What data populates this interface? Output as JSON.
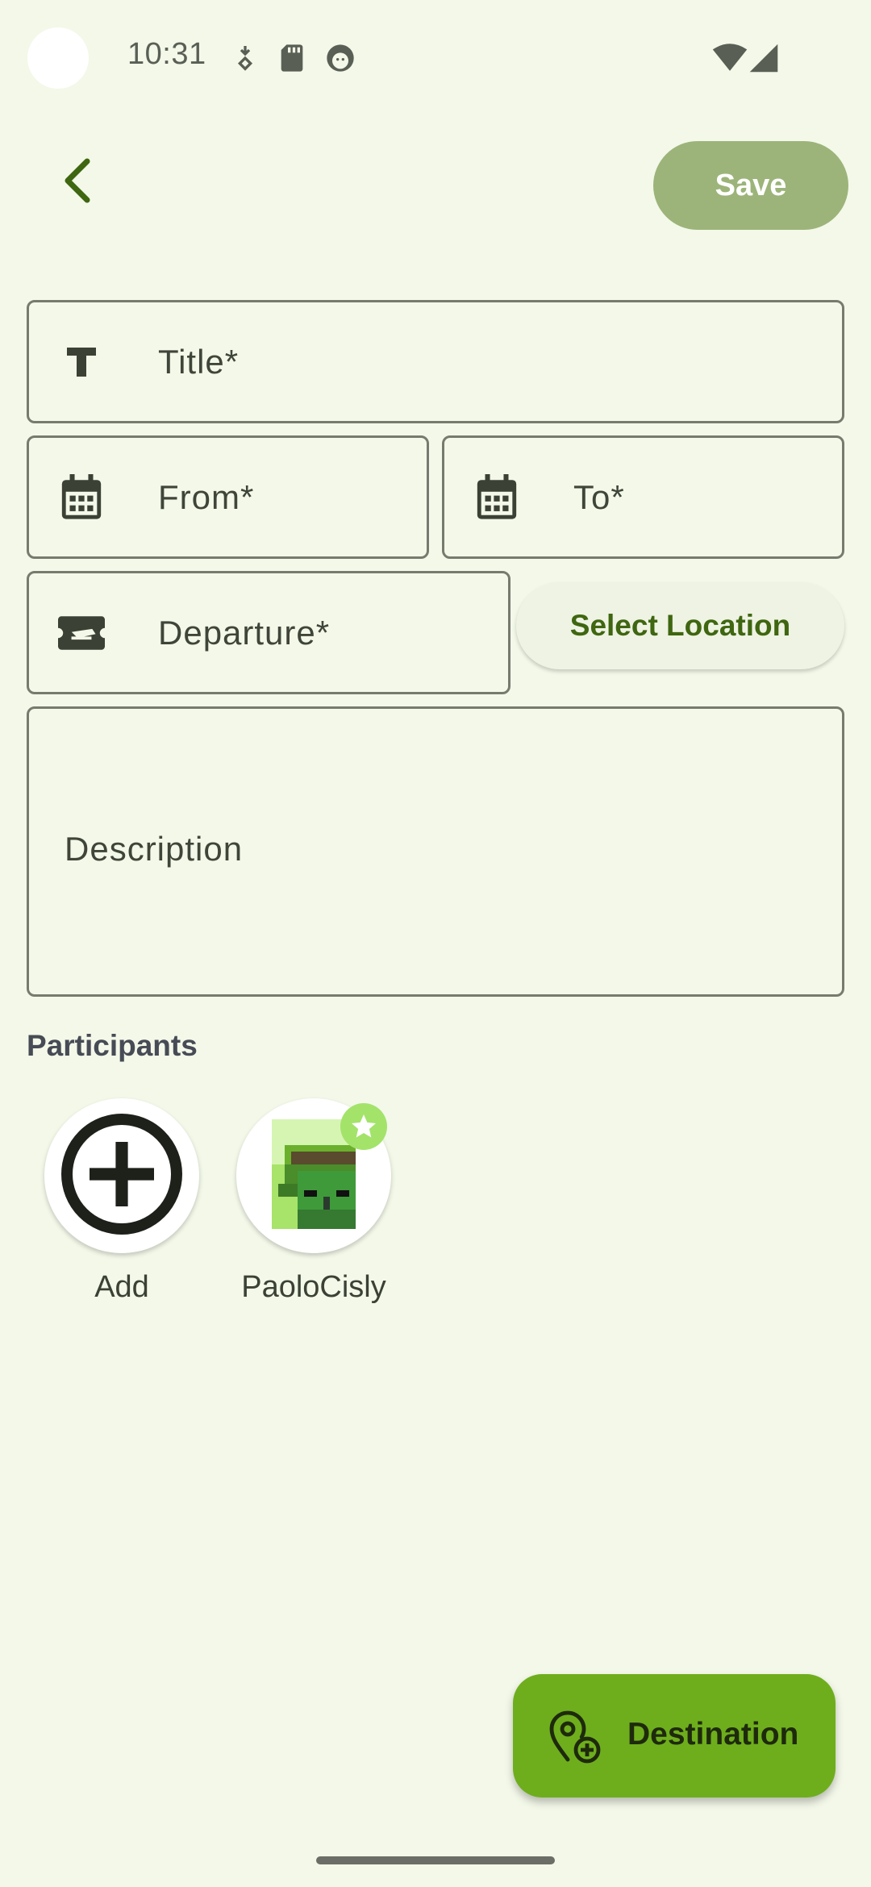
{
  "status_bar": {
    "time": "10:31",
    "icons": [
      "download-icon",
      "sd-card-icon",
      "face-icon",
      "wifi-icon",
      "signal-icon"
    ]
  },
  "app_bar": {
    "back_icon": "chevron-left-icon",
    "save_label": "Save"
  },
  "form": {
    "title": {
      "label": "Title*",
      "icon": "text-t-icon",
      "value": ""
    },
    "from": {
      "label": "From*",
      "icon": "calendar-icon",
      "value": ""
    },
    "to": {
      "label": "To*",
      "icon": "calendar-icon",
      "value": ""
    },
    "departure": {
      "label": "Departure*",
      "icon": "flight-ticket-icon",
      "value": ""
    },
    "select_location_label": "Select Location",
    "description": {
      "label": "Description",
      "value": ""
    }
  },
  "participants": {
    "title": "Participants",
    "items": [
      {
        "label": "Add",
        "icon": "add-circle-icon"
      },
      {
        "label": "PaoloCisly",
        "icon": "pixel-avatar",
        "badge": "star-icon"
      }
    ]
  },
  "fab": {
    "label": "Destination",
    "icon": "add-location-icon"
  },
  "colors": {
    "background": "#f3f8e9",
    "primary": "#6eae1d",
    "save_button": "#9cb479",
    "accent_text": "#3f6610",
    "star_badge": "#a3e36a"
  }
}
